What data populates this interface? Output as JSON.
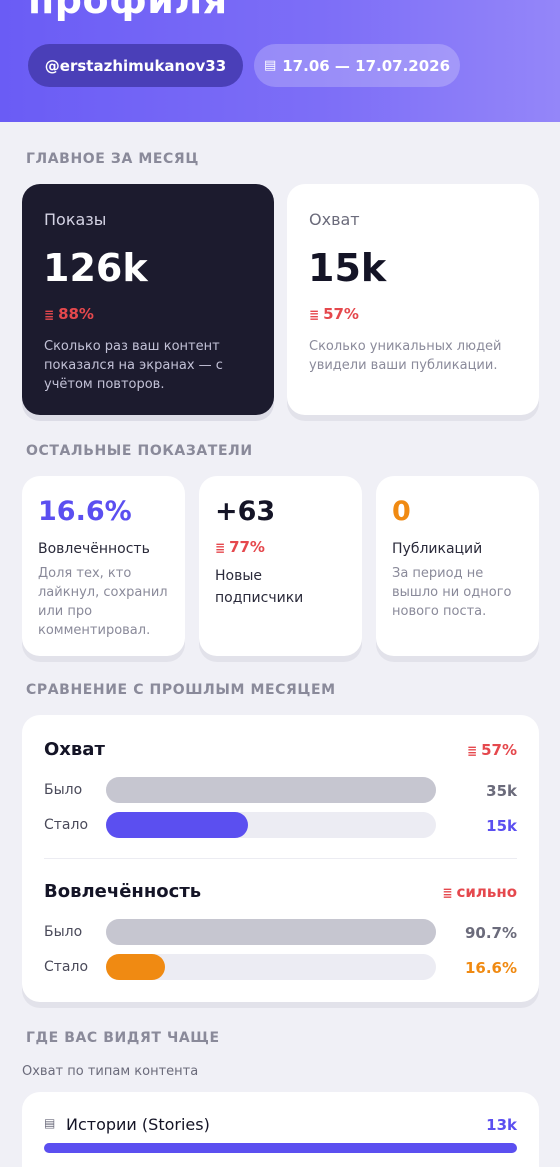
{
  "header": {
    "title": "профиля",
    "username": "@erstazhimukanov33",
    "date_icon": "calendar-icon",
    "date_range": "17.06 — 17.07.2026"
  },
  "main_section": {
    "label": "ГЛАВНОЕ ЗА МЕСЯЦ",
    "cards": [
      {
        "label": "Показы",
        "value": "126k",
        "delta_icon": "down-bars-icon",
        "delta": "88%",
        "description": "Сколько раз ваш контент показался на экранах — с учётом повторов."
      },
      {
        "label": "Охват",
        "value": "15k",
        "delta_icon": "down-bars-icon",
        "delta": "57%",
        "description": "Сколько уникальных людей увидели ваши публикации."
      }
    ]
  },
  "other_section": {
    "label": "ОСТАЛЬНЫЕ ПОКАЗАТЕЛИ",
    "engagement": {
      "value": "16.6%",
      "label": "Вовлечённость",
      "description": "Доля тех, кто лайкнул, сохранил или про комментировал."
    },
    "followers": {
      "value": "+63",
      "delta": "77%",
      "label": "Новые подписчики"
    },
    "posts": {
      "value": "0",
      "label": "Публикаций",
      "description": "За период не вышло ни одного нового поста."
    }
  },
  "comparison": {
    "label": "СРАВНЕНИЕ С ПРОШЛЫМ МЕСЯЦЕМ",
    "reach": {
      "title": "Охват",
      "delta": "57%",
      "before_label": "Было",
      "after_label": "Стало",
      "before_value": "35k",
      "after_value": "15k",
      "before_fraction": 1.0,
      "after_fraction": 0.43
    },
    "engagement": {
      "title": "Вовлечённость",
      "delta": "сильно",
      "before_label": "Было",
      "after_label": "Стало",
      "before_value": "90.7%",
      "after_value": "16.6%",
      "before_fraction": 1.0,
      "after_fraction": 0.18
    }
  },
  "where_seen": {
    "label": "ГДЕ ВАС ВИДЯТ ЧАЩЕ",
    "sublabel": "Охват по типам контента",
    "items": [
      {
        "icon": "stories-icon",
        "title": "Истории (Stories)",
        "value": "13k",
        "fraction": 1.0
      }
    ]
  },
  "colors": {
    "accent": "#5b4ff0",
    "negative": "#e5484d",
    "orange": "#f08a12",
    "dark_card": "#1c1b2e"
  }
}
